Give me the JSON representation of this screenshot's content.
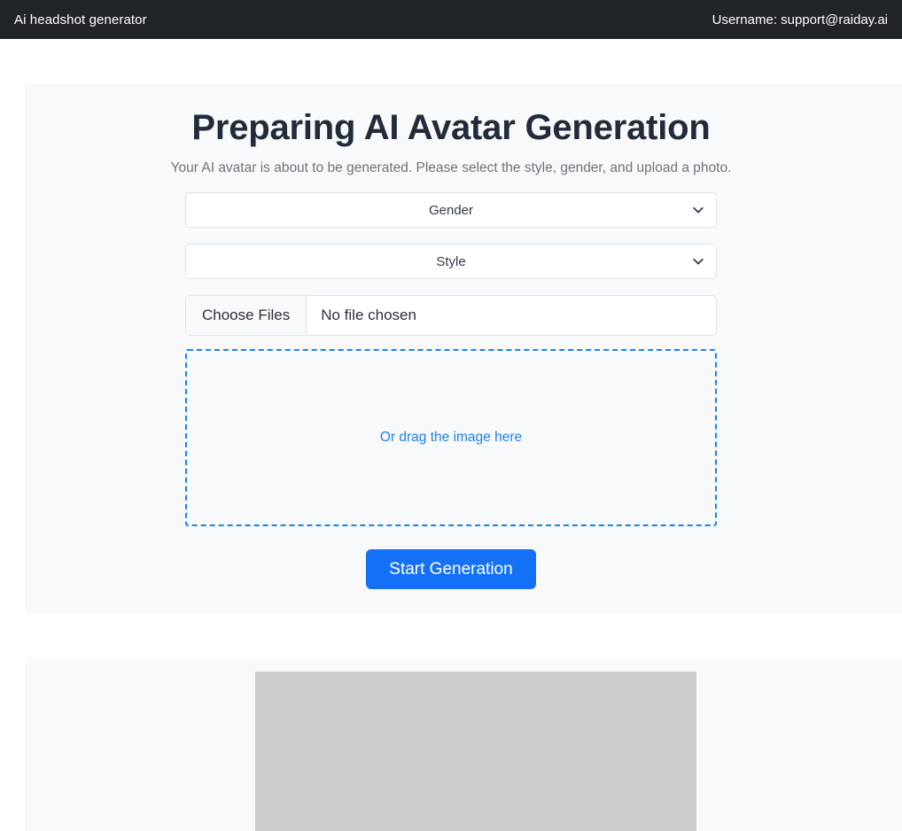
{
  "navbar": {
    "brand": "Ai headshot generator",
    "user_label": "Username: support@raiday.ai"
  },
  "main": {
    "title": "Preparing AI Avatar Generation",
    "subtitle": "Your AI avatar is about to be generated. Please select the style, gender, and upload a photo.",
    "gender_select": {
      "selected": "Gender",
      "icon": "chevron-down-icon"
    },
    "style_select": {
      "selected": "Style",
      "icon": "chevron-down-icon"
    },
    "file_input": {
      "button_label": "Choose Files",
      "status": "No file chosen"
    },
    "dropzone": {
      "text": "Or drag the image here"
    },
    "submit_button": {
      "label": "Start Generation"
    }
  },
  "colors": {
    "navbar_bg": "#212529",
    "card_bg": "#f8f9fa",
    "accent_blue": "#1471f5",
    "dropzone_border": "#1a82f5",
    "title": "#212b3a",
    "subtitle": "#6c757d",
    "placeholder": "#cccccc"
  }
}
